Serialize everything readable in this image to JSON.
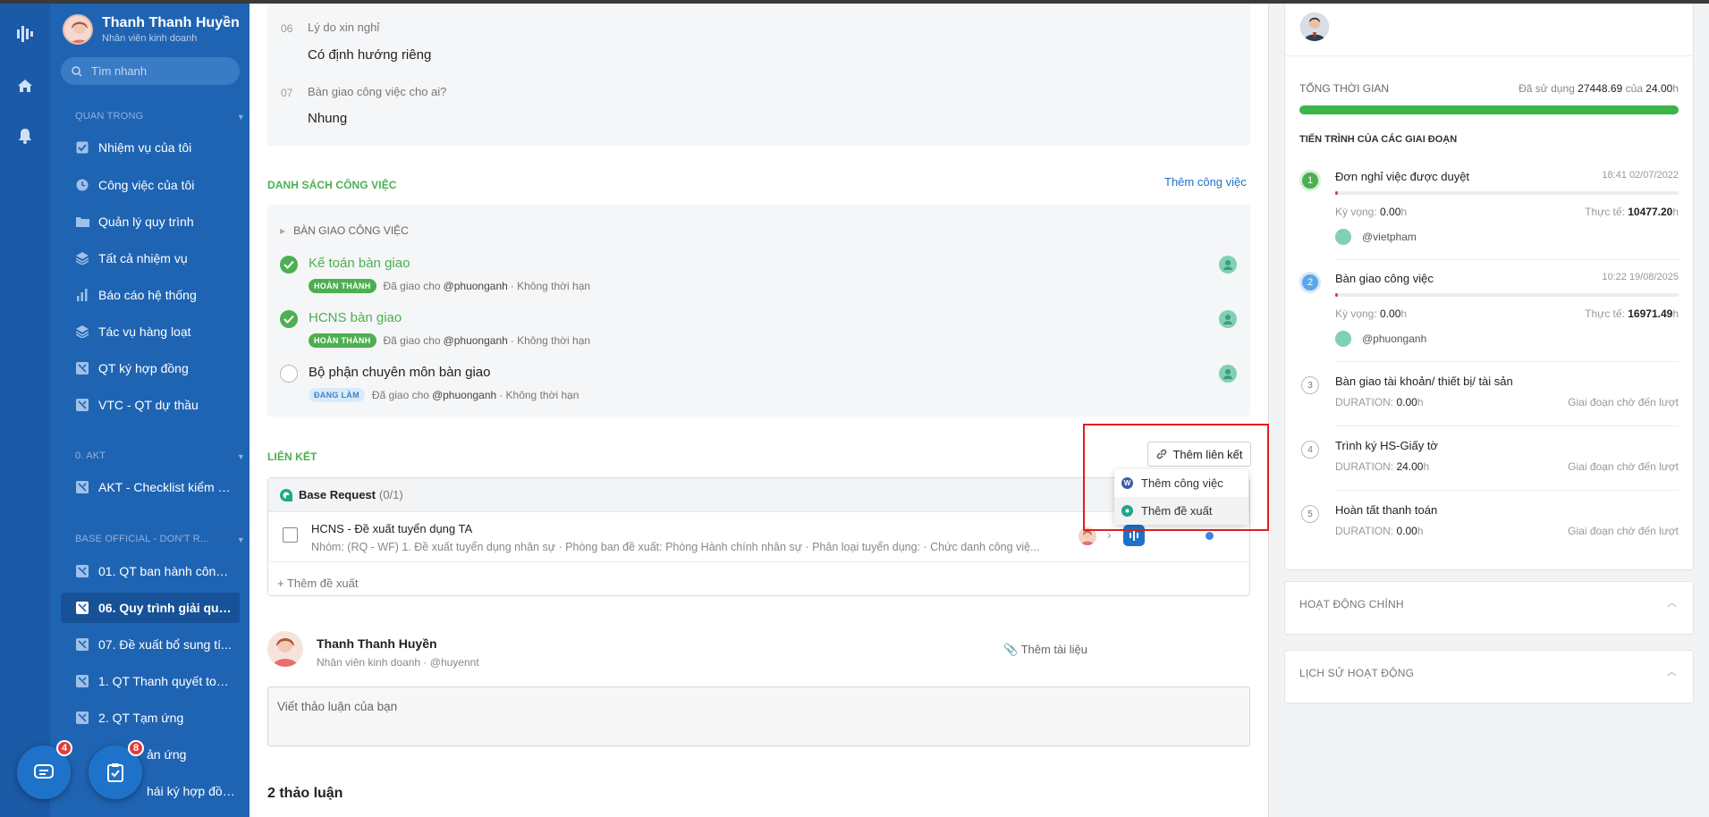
{
  "user": {
    "name": "Thanh Thanh Huyền",
    "role": "Nhân viên kinh doanh",
    "handle": "@huyennt"
  },
  "search": {
    "placeholder": "Tìm nhanh"
  },
  "sidebar": {
    "sections": [
      {
        "label": "QUAN TRỌNG"
      },
      {
        "label": "0. AKT"
      },
      {
        "label": "BASE OFFICIAL - DON'T R..."
      }
    ],
    "items": [
      {
        "label": "Nhiệm vụ của tôi",
        "icon": "checkbox-icon"
      },
      {
        "label": "Công việc của tôi",
        "icon": "clock-icon"
      },
      {
        "label": "Quản lý quy trình",
        "icon": "folder-icon"
      },
      {
        "label": "Tất cả nhiệm vụ",
        "icon": "layers-icon"
      },
      {
        "label": "Báo cáo hệ thống",
        "icon": "bar-chart-icon"
      },
      {
        "label": "Tác vụ hàng loạt",
        "icon": "layers-icon"
      },
      {
        "label": "QT ký hợp đồng",
        "icon": "workflow-icon"
      },
      {
        "label": "VTC - QT dự thầu",
        "icon": "workflow-icon"
      },
      {
        "label": "AKT - Checklist kiểm tr...",
        "icon": "workflow-icon"
      },
      {
        "label": "01. QT ban hành công ...",
        "icon": "workflow-icon"
      },
      {
        "label": "06. Quy trình giải quy...",
        "icon": "workflow-icon"
      },
      {
        "label": "07. Đề xuất bổ sung tí...",
        "icon": "workflow-icon"
      },
      {
        "label": "1. QT Thanh quyết toá...",
        "icon": "workflow-icon"
      },
      {
        "label": "2. QT Tạm ứng",
        "icon": "workflow-icon"
      },
      {
        "label": "ản ứng",
        "icon": "workflow-icon"
      },
      {
        "label": "hái ký hợp đồng ...",
        "icon": "workflow-icon"
      }
    ]
  },
  "fabs": {
    "chat_badge": "4",
    "task_badge": "8"
  },
  "form": {
    "questions": [
      {
        "num": "06",
        "label": "Lý do xin nghỉ",
        "answer": "Có định hướng riêng"
      },
      {
        "num": "07",
        "label": "Bàn giao công việc cho ai?",
        "answer": "Nhung"
      }
    ]
  },
  "tasks": {
    "title": "DANH SÁCH CÔNG VIỆC",
    "add_label": "Thêm công việc",
    "group": "BÀN GIAO CÔNG VIỆC",
    "items": [
      {
        "title": "Kế toán bàn giao",
        "status": "HOÀN THÀNH",
        "assigned": "Đã giao cho",
        "who": "@phuonganh",
        "deadline": "· Không thời hạn"
      },
      {
        "title": "HCNS bàn giao",
        "status": "HOÀN THÀNH",
        "assigned": "Đã giao cho",
        "who": "@phuonganh",
        "deadline": "· Không thời hạn"
      },
      {
        "title": "Bộ phận chuyên môn bàn giao",
        "status": "ĐANG LÀM",
        "assigned": "Đã giao cho",
        "who": "@phuonganh",
        "deadline": "· Không thời hạn"
      }
    ]
  },
  "links": {
    "title": "LIÊN KẾT",
    "add_link": "Thêm liên kết",
    "menu": [
      "Thêm công việc",
      "Thêm đề xuất"
    ],
    "group_name": "Base Request",
    "group_count": "(0/1)",
    "request_title": "HCNS - Đề xuất tuyển dụng TA",
    "request_sub": "Nhóm: (RQ - WF) 1. Đề xuất tuyển dụng nhân sự · Phòng ban đề xuất: Phòng Hành chính nhân sự · Phân loại tuyển dụng: · Chức danh công việ...",
    "add_proposal": "Thêm đề xuất"
  },
  "comment": {
    "attach": "Thêm tài liệu",
    "placeholder": "Viết thảo luận của bạn",
    "discussions": "2 thảo luận"
  },
  "right": {
    "total_label": "TỔNG THỜI GIAN",
    "used_prefix": "Đã sử dụng",
    "used_value": "27448.69",
    "used_of": "của",
    "used_total": "24.00",
    "used_unit": "h",
    "progress_fraction": 1.0,
    "stages_title": "TIẾN TRÌNH CỦA CÁC GIAI ĐOẠN",
    "stages": [
      {
        "num": "1",
        "title": "Đơn nghỉ việc được duyệt",
        "time": "18:41 02/07/2022",
        "expect_label": "Kỳ vọng:",
        "expect": "0.00",
        "actual_label": "Thực tế:",
        "actual": "10477.20",
        "user": "@vietpham"
      },
      {
        "num": "2",
        "title": "Bàn giao công việc",
        "time": "10:22 19/08/2025",
        "expect_label": "Kỳ vọng:",
        "expect": "0.00",
        "actual_label": "Thực tế:",
        "actual": "16971.49",
        "user": "@phuonganh"
      },
      {
        "num": "3",
        "title": "Bàn giao tài khoản/ thiết bị/ tài sản",
        "duration_label": "DURATION:",
        "duration": "0.00",
        "state": "Giai đoạn chờ đến lượt"
      },
      {
        "num": "4",
        "title": "Trình ký HS-Giấy tờ",
        "duration_label": "DURATION:",
        "duration": "24.00",
        "state": "Giai đoạn chờ đến lượt"
      },
      {
        "num": "5",
        "title": "Hoàn tất thanh toán",
        "duration_label": "DURATION:",
        "duration": "0.00",
        "state": "Giai đoạn chờ đến lượt"
      }
    ],
    "main_activity": "HOẠT ĐỘNG CHÍNH",
    "history": "LỊCH SỬ HOẠT ĐỘNG"
  },
  "colors": {
    "sidebar": "#1f64b3",
    "accent_green": "#4caf50",
    "link_blue": "#1f6fc9",
    "highlight_red": "#e01e1e"
  }
}
